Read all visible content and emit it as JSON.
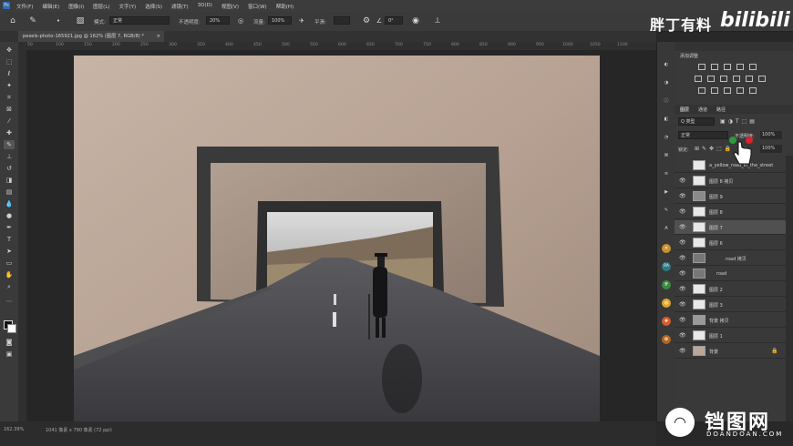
{
  "menu": {
    "items": [
      "文件(F)",
      "编辑(E)",
      "图像(I)",
      "图层(L)",
      "文字(Y)",
      "选择(S)",
      "滤镜(T)",
      "3D(D)",
      "视图(V)",
      "窗口(W)",
      "帮助(H)"
    ]
  },
  "options_bar": {
    "mode_label": "模式:",
    "mode_value": "正常",
    "opacity_label": "不透明度:",
    "opacity_value": "20%",
    "flow_label": "流量:",
    "flow_value": "100%",
    "smooth_label": "平滑:",
    "angle_value": "0°"
  },
  "document_tab": {
    "title": "pexels-photo-165921.jpg @ 162% (图层 7, RGB/8) *",
    "close": "×"
  },
  "ruler_ticks": [
    "50",
    "100",
    "150",
    "200",
    "250",
    "300",
    "350",
    "400",
    "450",
    "500",
    "550",
    "600",
    "650",
    "700",
    "750",
    "800",
    "850",
    "900",
    "950",
    "1000",
    "1050",
    "1100"
  ],
  "status_bar": {
    "zoom": "162.39%",
    "doc_info": "1041 像素 x 790 像素 (72 ppi)"
  },
  "adjustments_panel": {
    "title": "添加调整"
  },
  "layers_panel": {
    "tabs": [
      "图层",
      "通道",
      "路径"
    ],
    "filter_label": "Q 类型",
    "blend_mode": "正常",
    "opacity_label": "不透明度:",
    "opacity_value": "100%",
    "lock_label": "锁定:",
    "fill_label": "填充:",
    "fill_value": "100%",
    "layers": [
      {
        "name": "a_yellow_road_in_the_street"
      },
      {
        "name": "图层 8 拷贝"
      },
      {
        "name": "图层 9"
      },
      {
        "name": "图层 8"
      },
      {
        "name": "图层 7"
      },
      {
        "name": "图层 6"
      },
      {
        "name": "road 拷贝"
      },
      {
        "name": "road"
      },
      {
        "name": "图层 2"
      },
      {
        "name": "图层 3"
      },
      {
        "name": "背景 拷贝"
      },
      {
        "name": "图层 1"
      },
      {
        "name": "背景"
      }
    ]
  },
  "right_icon_column": {
    "badges": [
      "RA",
      "ff"
    ]
  },
  "watermarks": {
    "author": "胖丁有料",
    "site": "bilibili",
    "site_cn": "铛图网",
    "site_en": "DOANDOAN.COM"
  },
  "colors": {
    "accent": "#2b6cb3",
    "cursor_red": "#e0202a",
    "cursor_green": "#2f9a3a"
  }
}
